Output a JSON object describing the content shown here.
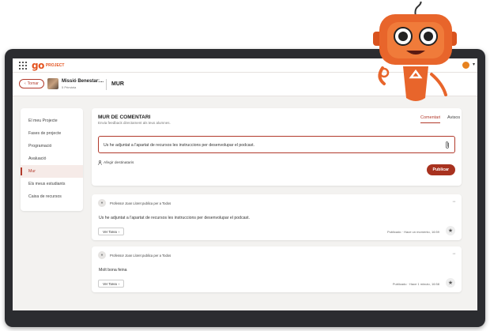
{
  "topbar": {
    "logo_go": "go",
    "logo_txt": "PROJECT"
  },
  "header": {
    "back_label": "Tornar",
    "course_title": "Missió Benestar:...",
    "course_sub": "5 Primària",
    "page_title": "MUR"
  },
  "sidebar": {
    "items": [
      {
        "label": "El meu Projecte"
      },
      {
        "label": "Fases de projecte"
      },
      {
        "label": "Programació"
      },
      {
        "label": "Avaluació"
      },
      {
        "label": "Mur"
      },
      {
        "label": "Els meus estudiants"
      },
      {
        "label": "Caixa de recursos"
      }
    ],
    "active_index": 4
  },
  "wall": {
    "title": "MUR DE COMENTARI",
    "subtitle": "Envia feedback directament als teus alumnes.",
    "tabs": [
      {
        "label": "Comentari"
      },
      {
        "label": "Avisos"
      }
    ],
    "compose_text": "Us he adjuntat a l'apartat de recursos les instruccions per desenvolupar el podcast.",
    "add_recipient": "Afegir destinataris",
    "publish_label": "Publicar"
  },
  "posts": [
    {
      "author": "Professor Joan Lloret publica per a Todos",
      "body": "Us he adjuntat a l'apartat de recursos les instruccions per desenvolupar el podcast.",
      "task_label": "Ver Tarea",
      "date": "Publicado · Hace un momento, 16:59"
    },
    {
      "author": "Professor Joan Lloret publica per a Todos",
      "body": "Molt bona feina",
      "task_label": "Ver Tarea",
      "date": "Publicado · Hace 1 minuto, 16:58"
    }
  ],
  "colors": {
    "accent": "#b23a2b",
    "brand": "#e4531f",
    "frame": "#2b2c30",
    "background": "#f3f2f0"
  },
  "icons": [
    "apps-grid-icon",
    "back-arrow-icon",
    "paperclip-icon",
    "person-icon",
    "more-icon",
    "star-icon",
    "user-avatar-icon",
    "robot-mascot"
  ]
}
